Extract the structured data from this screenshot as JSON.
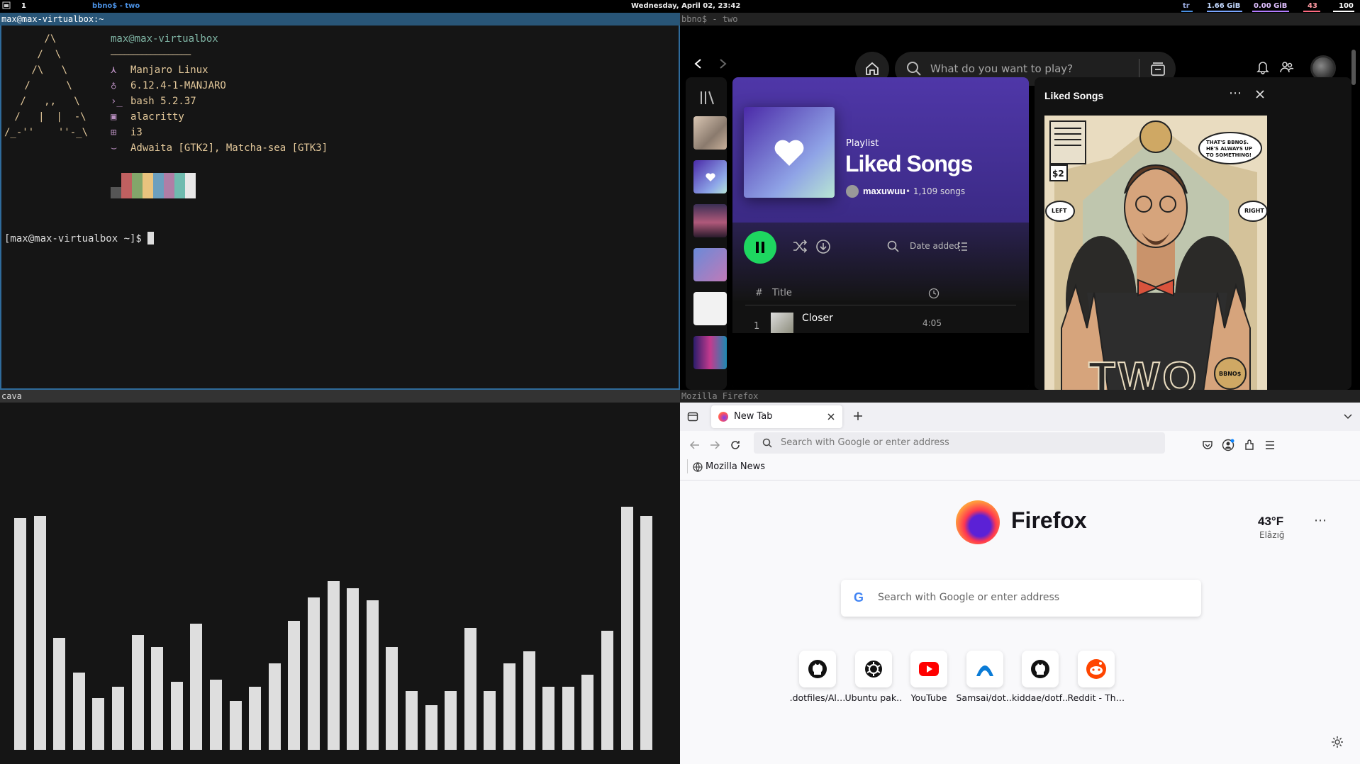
{
  "bar": {
    "workspace": "1",
    "focused_title": "bbno$ - two",
    "datetime": "Wednesday, April 02, 23:42",
    "layout": "tr",
    "mem": "1.66 GiB",
    "swap": "0.00 GiB",
    "temp": "43",
    "battery": "100"
  },
  "terminal": {
    "title": "max@max-virtualbox:~",
    "logo": [
      " /\\",
      " /  \\",
      " /\\   \\",
      " /      \\",
      " /   ,,   \\",
      " /   |  |  -\\",
      "/_-''    ''-_\\"
    ],
    "userhost": "max@max-virtualbox",
    "sep": "──────────────────",
    "info": [
      {
        "icon": "arch-icon",
        "value": "Manjaro Linux"
      },
      {
        "icon": "kernel-icon",
        "value": "6.12.4-1-MANJARO"
      },
      {
        "icon": "shell-icon",
        "value": "bash 5.2.37"
      },
      {
        "icon": "terminal-icon",
        "value": "alacritty"
      },
      {
        "icon": "wm-icon",
        "value": "i3"
      },
      {
        "icon": "theme-icon",
        "value": "Adwaita [GTK2], Matcha-sea [GTK3]"
      }
    ],
    "info_glyphs": [
      "⋏",
      "♁",
      "›_",
      "▣",
      "⊞",
      "⌣"
    ],
    "palette": [
      "#555555",
      "#c06060",
      "#83a66a",
      "#e9c37e",
      "#6c9fbe",
      "#b07ea6",
      "#6fbbaf",
      "#e8e8e8"
    ],
    "prompt": "[max@max-virtualbox ~]$ "
  },
  "spotify": {
    "title": "bbno$ - two",
    "search_placeholder": "What do you want to play?",
    "playlist_label": "Playlist",
    "playlist_title": "Liked Songs",
    "owner": "maxuwuu",
    "song_count": "• 1,109 songs",
    "sort_label": "Date added",
    "col_index": "#",
    "col_title": "Title",
    "track": {
      "index": "1",
      "title": "Closer",
      "duration": "4:05"
    },
    "panel_title": "Liked Songs",
    "art_text": {
      "bubble": "THAT'S BBNO$. HE'S ALWAYS UP TO SOMETHING!",
      "price": "$2",
      "left": "LEFT",
      "right": "RIGHT",
      "big": "TWO",
      "seal": "BBNO$"
    },
    "colors": {
      "green": "#1ed760",
      "purple": "#4b3a9a"
    }
  },
  "cava": {
    "title": "cava",
    "levels": [
      0.99,
      1.0,
      0.48,
      0.33,
      0.22,
      0.27,
      0.49,
      0.44,
      0.29,
      0.54,
      0.3,
      0.21,
      0.27,
      0.37,
      0.55,
      0.65,
      0.72,
      0.69,
      0.64,
      0.44,
      0.25,
      0.19,
      0.25,
      0.52,
      0.25,
      0.37,
      0.42,
      0.27,
      0.27,
      0.32,
      0.51,
      1.04,
      1.0
    ]
  },
  "firefox": {
    "title": "Mozilla Firefox",
    "tab_label": "New Tab",
    "url_placeholder": "Search with Google or enter address",
    "bookmark": "Mozilla News",
    "brand": "Firefox",
    "weather_temp": "43°F",
    "weather_city": "Elâzığ",
    "search_placeholder": "Search with Google or enter address",
    "shortcuts": [
      {
        "label": ".dotfiles/Al…",
        "icon": "github-icon"
      },
      {
        "label": "Ubuntu pak…",
        "icon": "openai-icon"
      },
      {
        "label": "YouTube",
        "icon": "youtube-icon"
      },
      {
        "label": "Samsai/dot…",
        "icon": "arc-icon"
      },
      {
        "label": "kiddae/dotf…",
        "icon": "github-icon"
      },
      {
        "label": "Reddit - Th…",
        "icon": "reddit-icon"
      }
    ]
  }
}
